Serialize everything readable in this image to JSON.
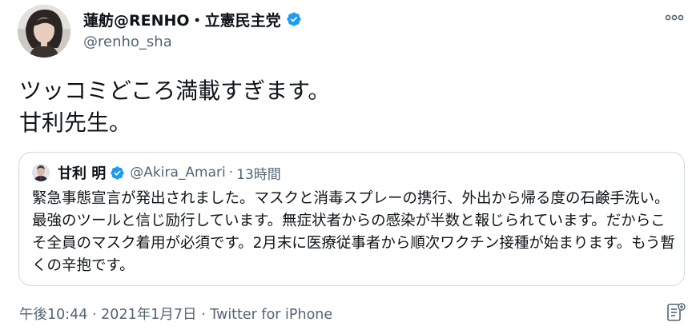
{
  "author": {
    "display_name": "蓮舫@RENHO・立憲民主党",
    "handle": "@renho_sha",
    "avatar_icon": "user-avatar-photo",
    "verified_icon": "verified-badge-icon"
  },
  "more_icon": "more-options-icon",
  "tweet": {
    "text": "ツッコミどころ満載すぎます。\n甘利先生。"
  },
  "quoted_tweet": {
    "display_name": "甘利 明",
    "handle": "@Akira_Amari",
    "separator": "·",
    "time": "13時間",
    "text": "緊急事態宣言が発出されました。マスクと消毒スプレーの携行、外出から帰る度の石鹸手洗い。最強のツールと信じ励行しています。無症状者からの感染が半数と報じられています。だからこそ全員のマスク着用が必須です。2月末に医療従事者から順次ワクチン接種が始まります。もう暫くの辛抱です。"
  },
  "meta": {
    "time": "午後10:44",
    "sep1": "·",
    "date": "2021年1月7日",
    "sep2": "·",
    "source": "Twitter for iPhone"
  },
  "analytics_icon": "analytics-icon",
  "colors": {
    "verified_blue": "#1d9bf0",
    "text": "#0f1419",
    "secondary": "#536471",
    "border": "#cfd9de"
  }
}
